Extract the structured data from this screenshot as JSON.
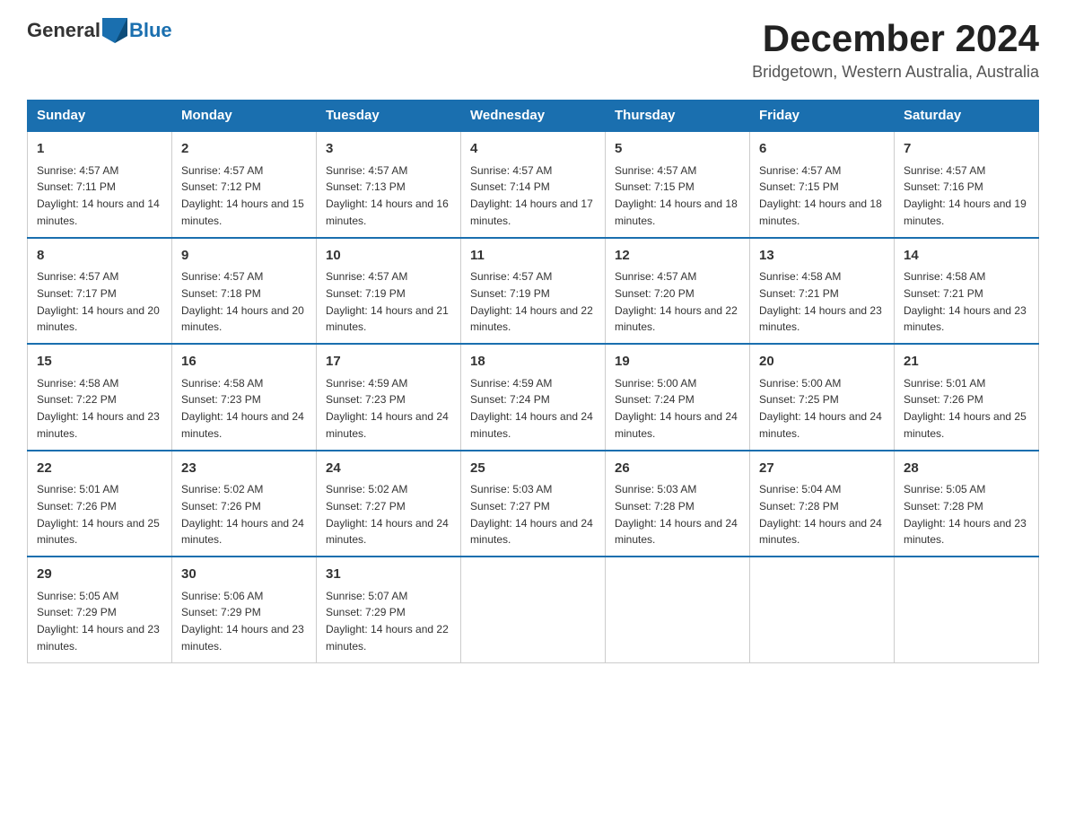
{
  "header": {
    "logo_general": "General",
    "logo_blue": "Blue",
    "month_title": "December 2024",
    "location": "Bridgetown, Western Australia, Australia"
  },
  "days_of_week": [
    "Sunday",
    "Monday",
    "Tuesday",
    "Wednesday",
    "Thursday",
    "Friday",
    "Saturday"
  ],
  "weeks": [
    [
      {
        "day": "1",
        "sunrise": "4:57 AM",
        "sunset": "7:11 PM",
        "daylight": "14 hours and 14 minutes."
      },
      {
        "day": "2",
        "sunrise": "4:57 AM",
        "sunset": "7:12 PM",
        "daylight": "14 hours and 15 minutes."
      },
      {
        "day": "3",
        "sunrise": "4:57 AM",
        "sunset": "7:13 PM",
        "daylight": "14 hours and 16 minutes."
      },
      {
        "day": "4",
        "sunrise": "4:57 AM",
        "sunset": "7:14 PM",
        "daylight": "14 hours and 17 minutes."
      },
      {
        "day": "5",
        "sunrise": "4:57 AM",
        "sunset": "7:15 PM",
        "daylight": "14 hours and 18 minutes."
      },
      {
        "day": "6",
        "sunrise": "4:57 AM",
        "sunset": "7:15 PM",
        "daylight": "14 hours and 18 minutes."
      },
      {
        "day": "7",
        "sunrise": "4:57 AM",
        "sunset": "7:16 PM",
        "daylight": "14 hours and 19 minutes."
      }
    ],
    [
      {
        "day": "8",
        "sunrise": "4:57 AM",
        "sunset": "7:17 PM",
        "daylight": "14 hours and 20 minutes."
      },
      {
        "day": "9",
        "sunrise": "4:57 AM",
        "sunset": "7:18 PM",
        "daylight": "14 hours and 20 minutes."
      },
      {
        "day": "10",
        "sunrise": "4:57 AM",
        "sunset": "7:19 PM",
        "daylight": "14 hours and 21 minutes."
      },
      {
        "day": "11",
        "sunrise": "4:57 AM",
        "sunset": "7:19 PM",
        "daylight": "14 hours and 22 minutes."
      },
      {
        "day": "12",
        "sunrise": "4:57 AM",
        "sunset": "7:20 PM",
        "daylight": "14 hours and 22 minutes."
      },
      {
        "day": "13",
        "sunrise": "4:58 AM",
        "sunset": "7:21 PM",
        "daylight": "14 hours and 23 minutes."
      },
      {
        "day": "14",
        "sunrise": "4:58 AM",
        "sunset": "7:21 PM",
        "daylight": "14 hours and 23 minutes."
      }
    ],
    [
      {
        "day": "15",
        "sunrise": "4:58 AM",
        "sunset": "7:22 PM",
        "daylight": "14 hours and 23 minutes."
      },
      {
        "day": "16",
        "sunrise": "4:58 AM",
        "sunset": "7:23 PM",
        "daylight": "14 hours and 24 minutes."
      },
      {
        "day": "17",
        "sunrise": "4:59 AM",
        "sunset": "7:23 PM",
        "daylight": "14 hours and 24 minutes."
      },
      {
        "day": "18",
        "sunrise": "4:59 AM",
        "sunset": "7:24 PM",
        "daylight": "14 hours and 24 minutes."
      },
      {
        "day": "19",
        "sunrise": "5:00 AM",
        "sunset": "7:24 PM",
        "daylight": "14 hours and 24 minutes."
      },
      {
        "day": "20",
        "sunrise": "5:00 AM",
        "sunset": "7:25 PM",
        "daylight": "14 hours and 24 minutes."
      },
      {
        "day": "21",
        "sunrise": "5:01 AM",
        "sunset": "7:26 PM",
        "daylight": "14 hours and 25 minutes."
      }
    ],
    [
      {
        "day": "22",
        "sunrise": "5:01 AM",
        "sunset": "7:26 PM",
        "daylight": "14 hours and 25 minutes."
      },
      {
        "day": "23",
        "sunrise": "5:02 AM",
        "sunset": "7:26 PM",
        "daylight": "14 hours and 24 minutes."
      },
      {
        "day": "24",
        "sunrise": "5:02 AM",
        "sunset": "7:27 PM",
        "daylight": "14 hours and 24 minutes."
      },
      {
        "day": "25",
        "sunrise": "5:03 AM",
        "sunset": "7:27 PM",
        "daylight": "14 hours and 24 minutes."
      },
      {
        "day": "26",
        "sunrise": "5:03 AM",
        "sunset": "7:28 PM",
        "daylight": "14 hours and 24 minutes."
      },
      {
        "day": "27",
        "sunrise": "5:04 AM",
        "sunset": "7:28 PM",
        "daylight": "14 hours and 24 minutes."
      },
      {
        "day": "28",
        "sunrise": "5:05 AM",
        "sunset": "7:28 PM",
        "daylight": "14 hours and 23 minutes."
      }
    ],
    [
      {
        "day": "29",
        "sunrise": "5:05 AM",
        "sunset": "7:29 PM",
        "daylight": "14 hours and 23 minutes."
      },
      {
        "day": "30",
        "sunrise": "5:06 AM",
        "sunset": "7:29 PM",
        "daylight": "14 hours and 23 minutes."
      },
      {
        "day": "31",
        "sunrise": "5:07 AM",
        "sunset": "7:29 PM",
        "daylight": "14 hours and 22 minutes."
      },
      {
        "day": "",
        "sunrise": "",
        "sunset": "",
        "daylight": ""
      },
      {
        "day": "",
        "sunrise": "",
        "sunset": "",
        "daylight": ""
      },
      {
        "day": "",
        "sunrise": "",
        "sunset": "",
        "daylight": ""
      },
      {
        "day": "",
        "sunrise": "",
        "sunset": "",
        "daylight": ""
      }
    ]
  ]
}
